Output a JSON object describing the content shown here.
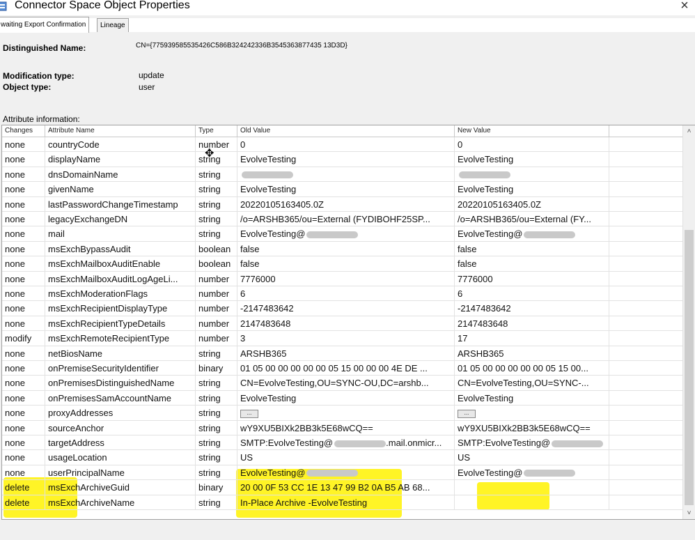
{
  "window": {
    "title": "Connector Space Object Properties",
    "close": "×"
  },
  "tabs": [
    {
      "label": "waiting Export Confirmation"
    },
    {
      "label": "Lineage"
    }
  ],
  "distinguished_name": {
    "label": "Distinguished Name:",
    "value": "CN={775939585535426C586B324242336B3545363877435 13D3D}"
  },
  "modification_type": {
    "label": "Modification type:",
    "value": "update"
  },
  "object_type": {
    "label": "Object type:",
    "value": "user"
  },
  "attr_info_label": "Attribute information:",
  "columns": [
    "Changes",
    "Attribute Name",
    "Type",
    "Old Value",
    "New Value"
  ],
  "rows": [
    {
      "change": "none",
      "name": "countryCode",
      "type": "number",
      "old": "0",
      "new": "0"
    },
    {
      "change": "none",
      "name": "displayName",
      "type": "string",
      "old": "EvolveTesting",
      "new": "EvolveTesting"
    },
    {
      "change": "none",
      "name": "dnsDomainName",
      "type": "string",
      "old": "",
      "new": ""
    },
    {
      "change": "none",
      "name": "givenName",
      "type": "string",
      "old": "EvolveTesting",
      "new": "EvolveTesting"
    },
    {
      "change": "none",
      "name": "lastPasswordChangeTimestamp",
      "type": "string",
      "old": "20220105163405.0Z",
      "new": "20220105163405.0Z"
    },
    {
      "change": "none",
      "name": "legacyExchangeDN",
      "type": "string",
      "old": "/o=ARSHB365/ou=External (FYDIBOHF25SP...",
      "new": "/o=ARSHB365/ou=External (FY..."
    },
    {
      "change": "none",
      "name": "mail",
      "type": "string",
      "old": "EvolveTesting@",
      "new": "EvolveTesting@"
    },
    {
      "change": "none",
      "name": "msExchBypassAudit",
      "type": "boolean",
      "old": "false",
      "new": "false"
    },
    {
      "change": "none",
      "name": "msExchMailboxAuditEnable",
      "type": "boolean",
      "old": "false",
      "new": "false"
    },
    {
      "change": "none",
      "name": "msExchMailboxAuditLogAgeLi...",
      "type": "number",
      "old": "7776000",
      "new": "7776000"
    },
    {
      "change": "none",
      "name": "msExchModerationFlags",
      "type": "number",
      "old": "6",
      "new": "6"
    },
    {
      "change": "none",
      "name": "msExchRecipientDisplayType",
      "type": "number",
      "old": "-2147483642",
      "new": "-2147483642"
    },
    {
      "change": "none",
      "name": "msExchRecipientTypeDetails",
      "type": "number",
      "old": "2147483648",
      "new": "2147483648"
    },
    {
      "change": "modify",
      "name": "msExchRemoteRecipientType",
      "type": "number",
      "old": "3",
      "new": "17"
    },
    {
      "change": "none",
      "name": "netBiosName",
      "type": "string",
      "old": "ARSHB365",
      "new": "ARSHB365"
    },
    {
      "change": "none",
      "name": "onPremiseSecurityIdentifier",
      "type": "binary",
      "old": "01 05 00 00 00 00 00 05 15 00 00 00 4E DE ...",
      "new": "01 05 00 00 00 00 00 05 15 00..."
    },
    {
      "change": "none",
      "name": "onPremisesDistinguishedName",
      "type": "string",
      "old": "CN=EvolveTesting,OU=SYNC-OU,DC=arshb...",
      "new": "CN=EvolveTesting,OU=SYNC-..."
    },
    {
      "change": "none",
      "name": "onPremisesSamAccountName",
      "type": "string",
      "old": "EvolveTesting",
      "new": "EvolveTesting"
    },
    {
      "change": "none",
      "name": "proxyAddresses",
      "type": "string",
      "old": "...",
      "new": "..."
    },
    {
      "change": "none",
      "name": "sourceAnchor",
      "type": "string",
      "old": "wY9XU5BIXk2BB3k5E68wCQ==",
      "new": "wY9XU5BIXk2BB3k5E68wCQ=="
    },
    {
      "change": "none",
      "name": "targetAddress",
      "type": "string",
      "old": "SMTP:EvolveTesting@",
      "new": "SMTP:EvolveTesting@"
    },
    {
      "change": "none",
      "name": "usageLocation",
      "type": "string",
      "old": "US",
      "new": "US"
    },
    {
      "change": "none",
      "name": "userPrincipalName",
      "type": "string",
      "old": "EvolveTesting@",
      "new": "EvolveTesting@"
    },
    {
      "change": "delete",
      "name": "msExchArchiveGuid",
      "type": "binary",
      "old": "20 00 0F 53 CC 1E 13 47 99 B2 0A B5 AB 68...",
      "new": ""
    },
    {
      "change": "delete",
      "name": "msExchArchiveName",
      "type": "string",
      "old": "In-Place Archive -EvolveTesting",
      "new": ""
    }
  ],
  "blurred_cells": {
    "2": [
      "old",
      "new"
    ],
    "6": [
      "old_suffix",
      "new_suffix"
    ],
    "20": [
      "old_suffix_tail",
      "new_suffix"
    ],
    "22": [
      "old_suffix",
      "new_suffix"
    ]
  },
  "old_suffix_text": {
    "20": ".mail.onmicr..."
  },
  "ellipsis_button_rows": [
    18
  ],
  "highlight_color": "#fff200",
  "scroll": {
    "up": "˄",
    "down": "˅"
  }
}
